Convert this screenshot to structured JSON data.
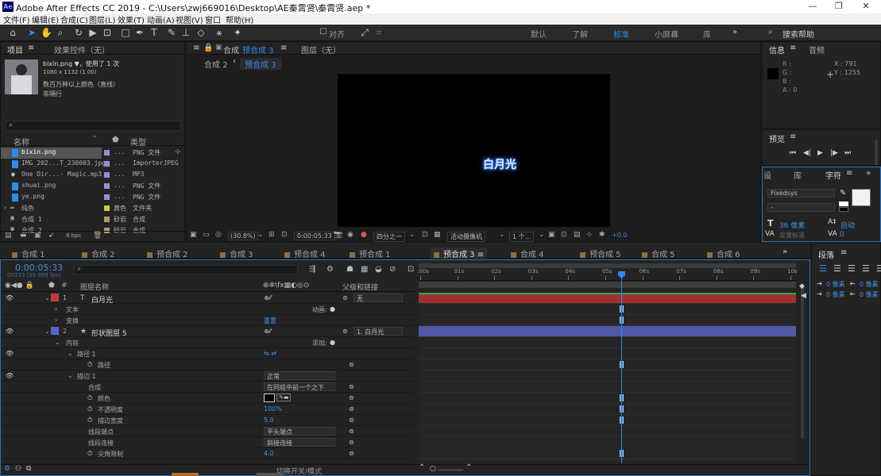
{
  "title": "Adobe After Effects CC 2019 - C:\\Users\\zwj669016\\Desktop\\AE秦霄贤\\秦霄贤.aep *",
  "menu": [
    "文件(F)",
    "编辑(E)",
    "合成(C)",
    "图层(L)",
    "效果(T)",
    "动画(A)",
    "视图(V)",
    "窗口",
    "帮助(H)"
  ],
  "toolbar": {
    "align": "对齐",
    "workspaces": [
      "默认",
      "了解",
      "标准",
      "小屏幕",
      "库"
    ],
    "search": "搜索帮助"
  },
  "project": {
    "tab1": "项目",
    "tab2": "效果控件（无）",
    "file": "bixin.png ▼",
    "usage": "，使用了 1 次",
    "dims": "1080 x 1132 (1.00)",
    "color": "数百万种以上颜色（直线）",
    "interlace": "非隔行",
    "col_name": "名称",
    "col_type": "类型",
    "bpc": "8 bpc",
    "items": [
      {
        "name": "bixin.png",
        "label": "...",
        "type": "PNG 文件",
        "color": "#9a8fd6"
      },
      {
        "name": "IMG_202...T_230003.jpg",
        "label": "...",
        "type": "ImporterJPEG",
        "color": "#9a8fd6"
      },
      {
        "name": "One Dir...- Magic.mp3",
        "label": "...",
        "type": "MP3",
        "color": "#9a8fd6"
      },
      {
        "name": "shuai.png",
        "label": "...",
        "type": "PNG 文件",
        "color": "#9a8fd6"
      },
      {
        "name": "ye.png",
        "label": "...",
        "type": "PNG 文件",
        "color": "#9a8fd6"
      },
      {
        "name": "纯色",
        "label": "黄色",
        "type": "文件夹",
        "color": "#d6c44a"
      },
      {
        "name": "合成 1",
        "label": "砂岩",
        "type": "合成",
        "color": "#b39870"
      },
      {
        "name": "合成 2",
        "label": "砂岩",
        "type": "合成",
        "color": "#b39870"
      }
    ]
  },
  "viewer": {
    "tab_prefix": "合成",
    "tab_active": "预合成 3",
    "tab_layer": "图层（无）",
    "crumb1": "合成 2",
    "crumb2": "预合成 3",
    "text": "白月光",
    "zoom": "(30.8%)",
    "time": "0:00:05:33",
    "res": "四分之一",
    "camera": "活动摄像机",
    "views": "1 个...",
    "exposure": "+0.0"
  },
  "info": {
    "tab1": "信息",
    "tab2": "音频",
    "r": "R :",
    "g": "G :",
    "b": "B :",
    "a": "A : 0",
    "x": "X : 791",
    "y": "Y : 1255"
  },
  "preview": {
    "title": "预览"
  },
  "character": {
    "tab1": "设",
    "tab2": "库",
    "tab3": "字符",
    "font": "Fixedsys",
    "style": "-",
    "size": "36 像素",
    "leading": "自动",
    "tracking_label": "度量标准",
    "tracking_val": "0"
  },
  "paragraph": {
    "title": "段落",
    "v1": "0 像素",
    "v2": "0 像素",
    "v3": "0 像素",
    "v4": "0 像素"
  },
  "timeline": {
    "tabs": [
      "合成 1",
      "合成 2",
      "预合成 2",
      "合成 3",
      "预合成 4",
      "预合成 1",
      "预合成 3",
      "合成 4",
      "预合成 5",
      "合成 5",
      "合成 6"
    ],
    "active_tab": "预合成 3",
    "time": "0:00:05:33",
    "frames": "00333 (59.999 fps)",
    "col_layer": "图层名称",
    "col_parent": "父级和链接",
    "ruler": [
      ":00s",
      "01s",
      "02s",
      "03s",
      "04s",
      "05s",
      "06s",
      "07s",
      "08s",
      "09s",
      "10s"
    ],
    "layers": [
      {
        "num": "1",
        "name": "白月光",
        "parent": "无",
        "color": "#c23b3b"
      },
      {
        "num": "2",
        "name": "形状图层 5",
        "parent": "1. 白月光",
        "color": "#5865c6"
      }
    ],
    "props": {
      "text": "文本",
      "transform": "变换",
      "animate": "动画:",
      "reset": "重置",
      "contents": "内容",
      "add": "添加:",
      "path1": "路径 1",
      "path": "路径",
      "stroke1": "描边 1",
      "composite": "合成",
      "color": "颜色",
      "opacity": "不透明度",
      "width": "描边宽度",
      "cap": "线段端点",
      "join": "线段连接",
      "miter": "尖角限制",
      "blend": "正常",
      "composite_val": "在同组中前一个之下",
      "opacity_val": "100%",
      "width_val": "5.0",
      "cap_val": "平头端点",
      "join_val": "斜接连接",
      "miter_val": "4.0"
    },
    "toggle": "切换开关/模式"
  }
}
